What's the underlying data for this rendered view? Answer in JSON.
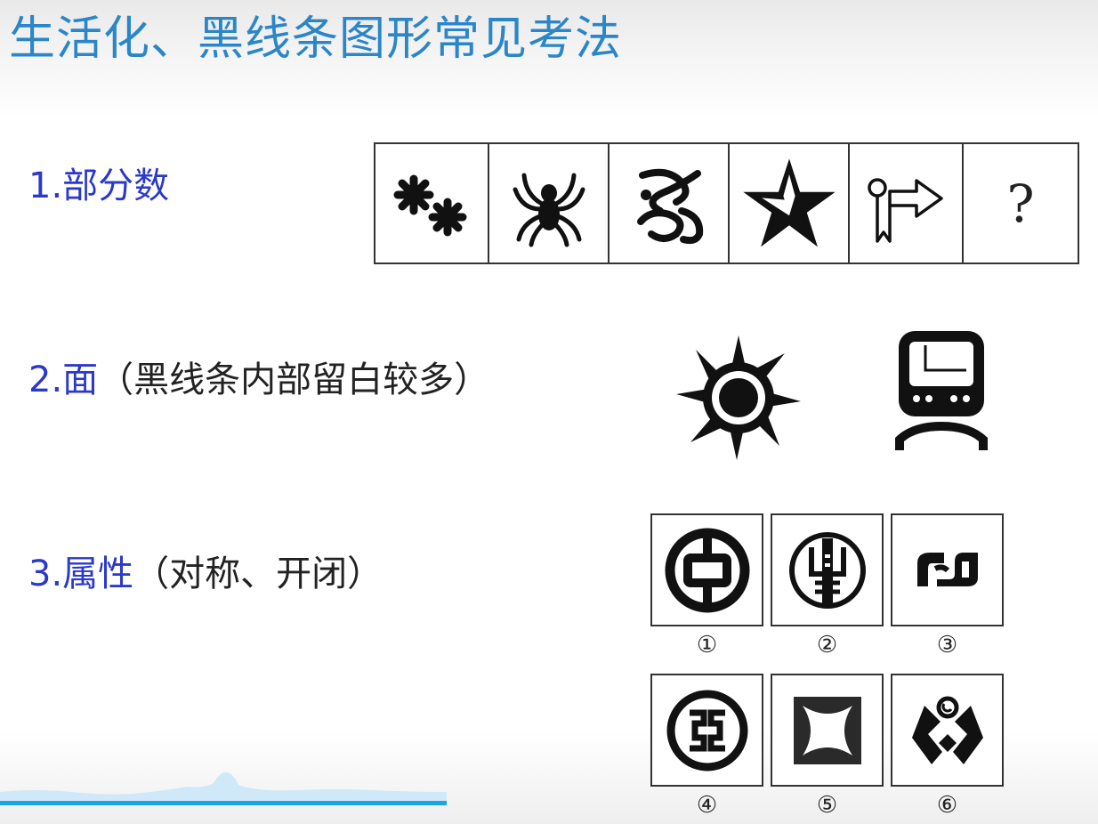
{
  "title": "生活化、黑线条图形常见考法",
  "items": [
    {
      "num": "1.部分数",
      "note": ""
    },
    {
      "num": "2.面",
      "note": "（黑线条内部留白较多）"
    },
    {
      "num": "3.属性",
      "note": "（对称、开闭）"
    }
  ],
  "row1": {
    "icons": [
      "asterisks-icon",
      "spider-icon",
      "ornament-icon",
      "star-icon",
      "arrow-sign-icon"
    ],
    "question": "?"
  },
  "row2": {
    "icons": [
      "sun-icon",
      "train-icon"
    ]
  },
  "options": [
    {
      "label": "①",
      "icon": "bank-of-china-logo-icon"
    },
    {
      "label": "②",
      "icon": "agricultural-bank-logo-icon"
    },
    {
      "label": "③",
      "icon": "spd-bank-logo-icon"
    },
    {
      "label": "④",
      "icon": "icbc-logo-icon"
    },
    {
      "label": "⑤",
      "icon": "square-star-logo-icon"
    },
    {
      "label": "⑥",
      "icon": "hands-logo-icon"
    }
  ]
}
